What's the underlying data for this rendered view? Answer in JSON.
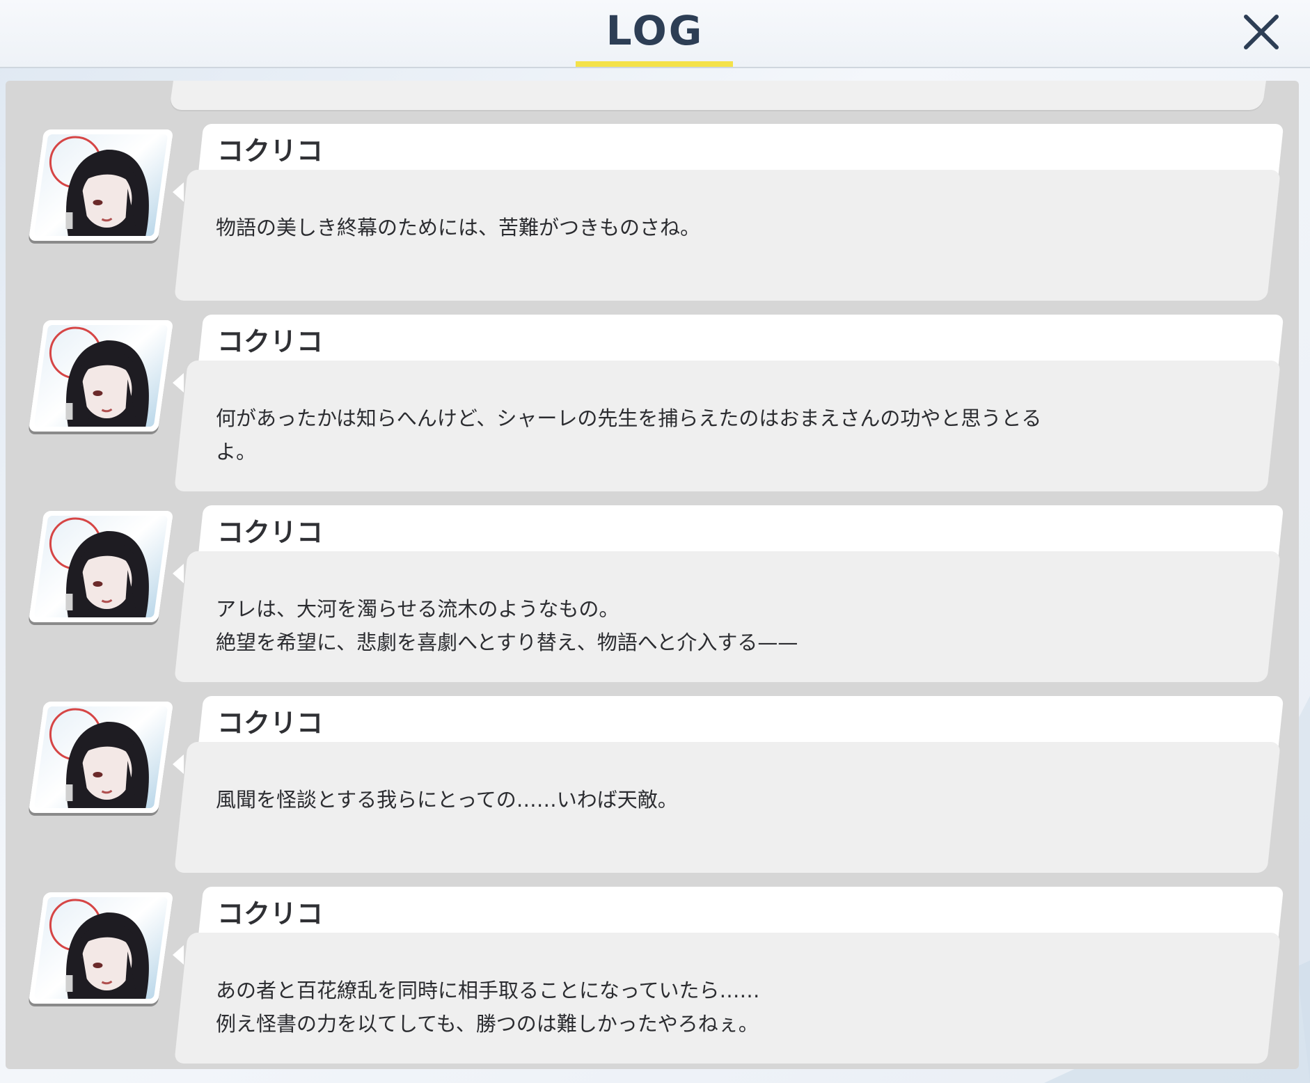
{
  "header": {
    "title": "LOG",
    "accent_color": "#f4e24a",
    "close_icon": "close-icon"
  },
  "log": {
    "entries": [
      {
        "speaker": "コクリコ",
        "lines": [
          "物語の美しき終幕のためには、苦難がつきものさね。",
          ""
        ]
      },
      {
        "speaker": "コクリコ",
        "lines": [
          "何があったかは知らへんけど、シャーレの先生を捕らえたのはおまえさんの功やと思うとる",
          "よ。"
        ]
      },
      {
        "speaker": "コクリコ",
        "lines": [
          "アレは、大河を濁らせる流木のようなもの。",
          "絶望を希望に、悲劇を喜劇へとすり替え、物語へと介入する——"
        ]
      },
      {
        "speaker": "コクリコ",
        "lines": [
          "風聞を怪談とする我らにとっての……いわば天敵。",
          ""
        ]
      },
      {
        "speaker": "コクリコ",
        "lines": [
          "あの者と百花繚乱を同時に相手取ることになっていたら……",
          "例え怪書の力を以てしても、勝つのは難しかったやろねぇ。"
        ]
      }
    ]
  }
}
